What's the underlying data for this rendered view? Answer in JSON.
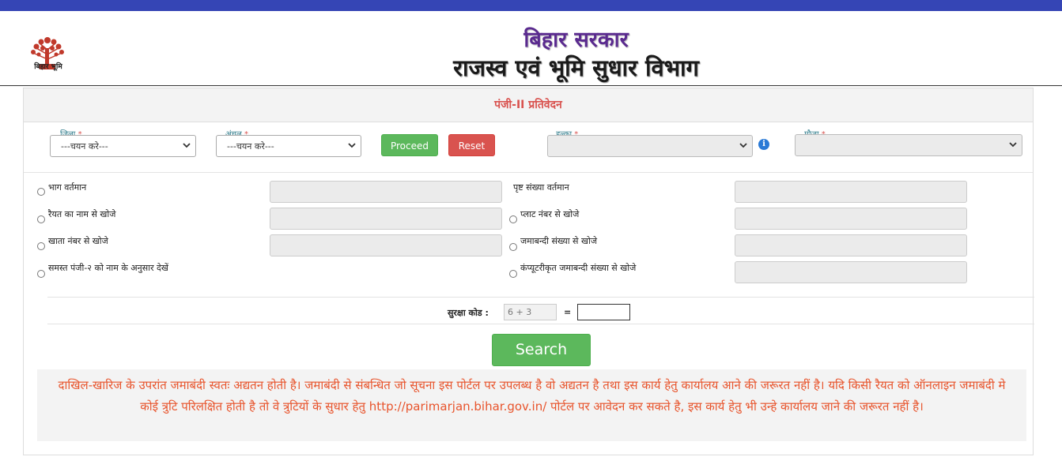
{
  "header": {
    "logo_caption": "बिहार भूमि",
    "title_line1": "बिहार सरकार",
    "title_line2": "राजस्व एवं भूमि सुधार विभाग"
  },
  "panel": {
    "title": "पंजी-II प्रतिवेदन"
  },
  "filters": {
    "district": {
      "label": "जिला",
      "required_mark": "*",
      "value": "---चयन करे---"
    },
    "circle": {
      "label": "अंचल",
      "required_mark": "*",
      "value": "---चयन करे---"
    },
    "proceed_label": "Proceed",
    "reset_label": "Reset",
    "halka": {
      "label": "हल्का",
      "required_mark": "*",
      "value": ""
    },
    "mauja": {
      "label": "मौजा",
      "required_mark": "*",
      "value": ""
    },
    "info_glyph": "i"
  },
  "search_options": {
    "left": [
      {
        "label": "भाग वर्तमान"
      },
      {
        "label": "रैयत का नाम से खोजे"
      },
      {
        "label": "खाता नंबर से खोजे"
      },
      {
        "label": "समस्त पंजी-२ को नाम के अनुसार देखें"
      }
    ],
    "right": [
      {
        "label": "पृष्ट संख्या वर्तमान"
      },
      {
        "label": "प्लाट नंबर से खोजे"
      },
      {
        "label": "जमाबन्दी संख्या से खोजे"
      },
      {
        "label": "कंप्यूटरीकृत जमाबन्दी संख्या से खोजे"
      }
    ]
  },
  "captcha": {
    "label": "सुरक्षा कोड :",
    "expression": "6 + 3",
    "equals": "="
  },
  "search_button_label": "Search",
  "notice": "दाखिल-खारिज के उपरांत जमाबंदी स्वतः अद्यतन होती है। जमाबंदी से संबन्धित जो सूचना इस पोर्टल पर उपलब्ध है वो अद्यतन है तथा इस कार्य हेतु कार्यालय आने की जरूरत नहीं है। यदि किसी रैयत को ऑनलाइन जमाबंदी मे कोई त्रुटि परिलक्षित होती है तो वे त्रुटियों के सुधार हेतु http://parimarjan.bihar.gov.in/ पोर्टल पर आवेदन कर सकते है, इस कार्य हेतु भी उन्हे कार्यालय जाने की जरूरत नहीं है।",
  "colors": {
    "top_bar": "#3545b5",
    "title_purple": "#5a2a8f",
    "accent_red": "#d9534f",
    "button_green": "#5cb85c",
    "notice_text": "#e8542c"
  }
}
